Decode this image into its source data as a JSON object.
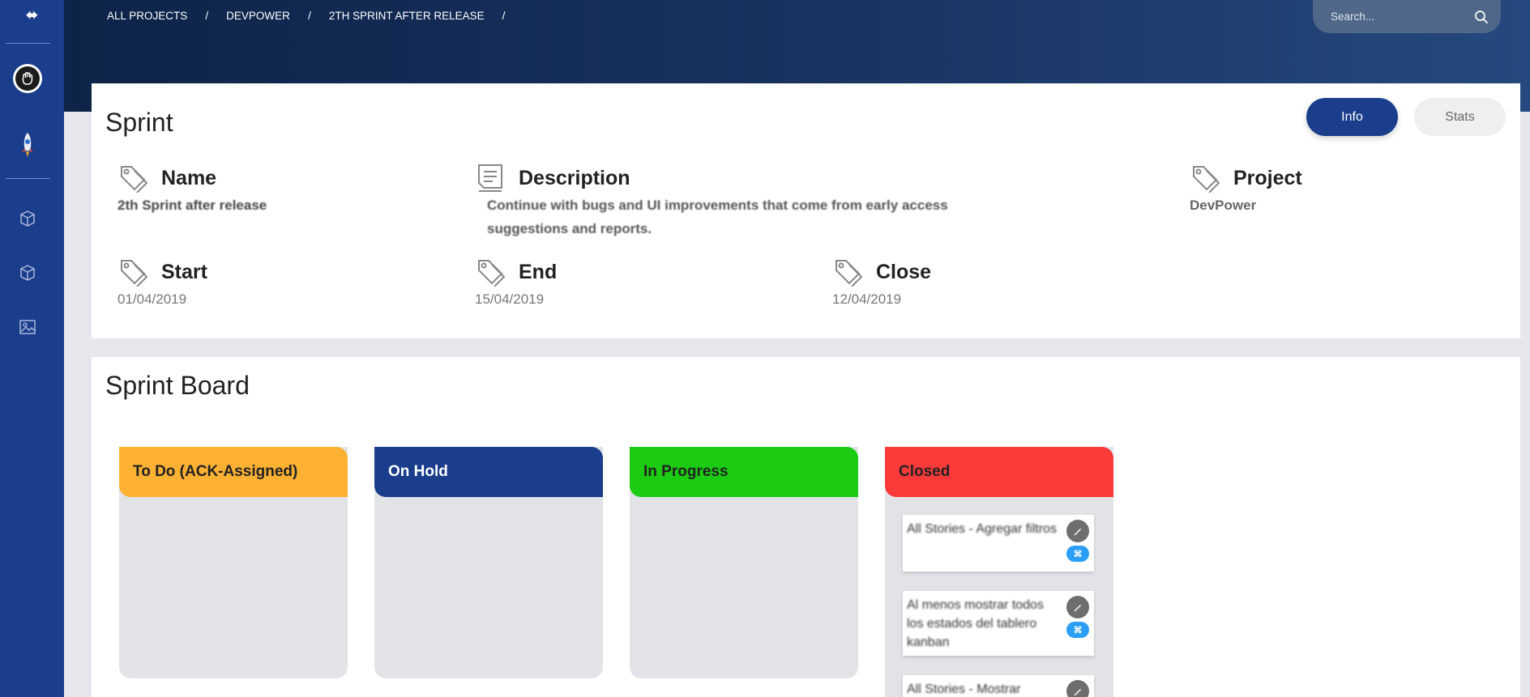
{
  "sidebar": {
    "logo_text": "⬌",
    "items": [
      {
        "icon": "avatar-fist-icon"
      },
      {
        "icon": "rocket-icon"
      },
      {
        "icon": "box-icon"
      },
      {
        "icon": "box-icon"
      },
      {
        "icon": "image-icon"
      }
    ]
  },
  "breadcrumb": {
    "items": [
      "ALL PROJECTS",
      "DEVPOWER",
      "2TH SPRINT AFTER RELEASE"
    ],
    "separator": "/"
  },
  "search": {
    "placeholder": "Search..."
  },
  "sprint": {
    "title": "Sprint",
    "tabs": {
      "info": "Info",
      "stats": "Stats"
    },
    "fields": {
      "name": {
        "label": "Name",
        "value": "2th Sprint after release"
      },
      "description": {
        "label": "Description",
        "value_line1": "Continue with bugs and UI improvements that come from early access",
        "value_line2": "suggestions and reports."
      },
      "project": {
        "label": "Project",
        "value": "DevPower"
      },
      "start": {
        "label": "Start",
        "value": "01/04/2019"
      },
      "end": {
        "label": "End",
        "value": "15/04/2019"
      },
      "close": {
        "label": "Close",
        "value": "12/04/2019"
      }
    }
  },
  "board": {
    "title": "Sprint Board",
    "columns": [
      {
        "label": "To Do (ACK-Assigned)",
        "color": "#fdb133",
        "text_color": "#222222"
      },
      {
        "label": "On Hold",
        "color": "#1a3d8c",
        "text_color": "#ffffff"
      },
      {
        "label": "In Progress",
        "color": "#1bcc13",
        "text_color": "#222222"
      },
      {
        "label": "Closed",
        "color": "#fb3a3a",
        "text_color": "#222222"
      }
    ],
    "closed_tasks": [
      {
        "text": "All Stories - Agregar filtros"
      },
      {
        "text": "Al menos mostrar todos los estados del tablero kanban"
      },
      {
        "text": "All Stories - Mostrar"
      }
    ],
    "flag_label": "⌘"
  },
  "colors": {
    "sidebar": "#1a3d8c",
    "accent": "#1a3d8c",
    "header_start": "#0d2348",
    "header_end": "#25497e"
  }
}
